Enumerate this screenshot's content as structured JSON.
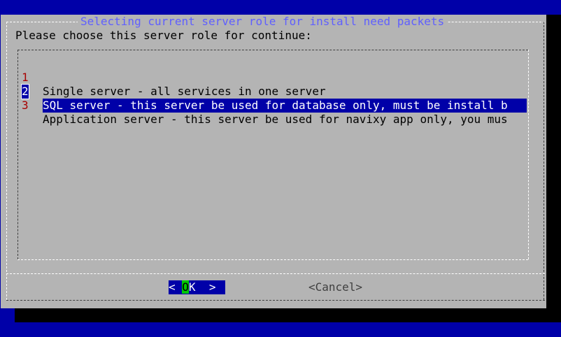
{
  "dialog": {
    "title": "Selecting current server role for install need packets",
    "prompt": "Please choose this server role for continue:"
  },
  "menu": {
    "items": [
      {
        "tag": "1",
        "label": "Single server - all services in one server",
        "selected": false
      },
      {
        "tag": "2",
        "label": "SQL server - this server be used for database only, must be install b",
        "selected": true
      },
      {
        "tag": "3",
        "label": "Application server - this server be used for navixy app only, you mus",
        "selected": false
      }
    ]
  },
  "buttons": {
    "ok_left": "<",
    "ok_hot": "O",
    "ok_rest": "K",
    "ok_right": ">",
    "cancel": "<Cancel>"
  },
  "colors": {
    "background": "#0000a8",
    "dialog": "#b4b4b4",
    "title": "#5f5fff",
    "selection": "#0000a8",
    "tag": "#a80000",
    "hotkey": "#00c800"
  }
}
